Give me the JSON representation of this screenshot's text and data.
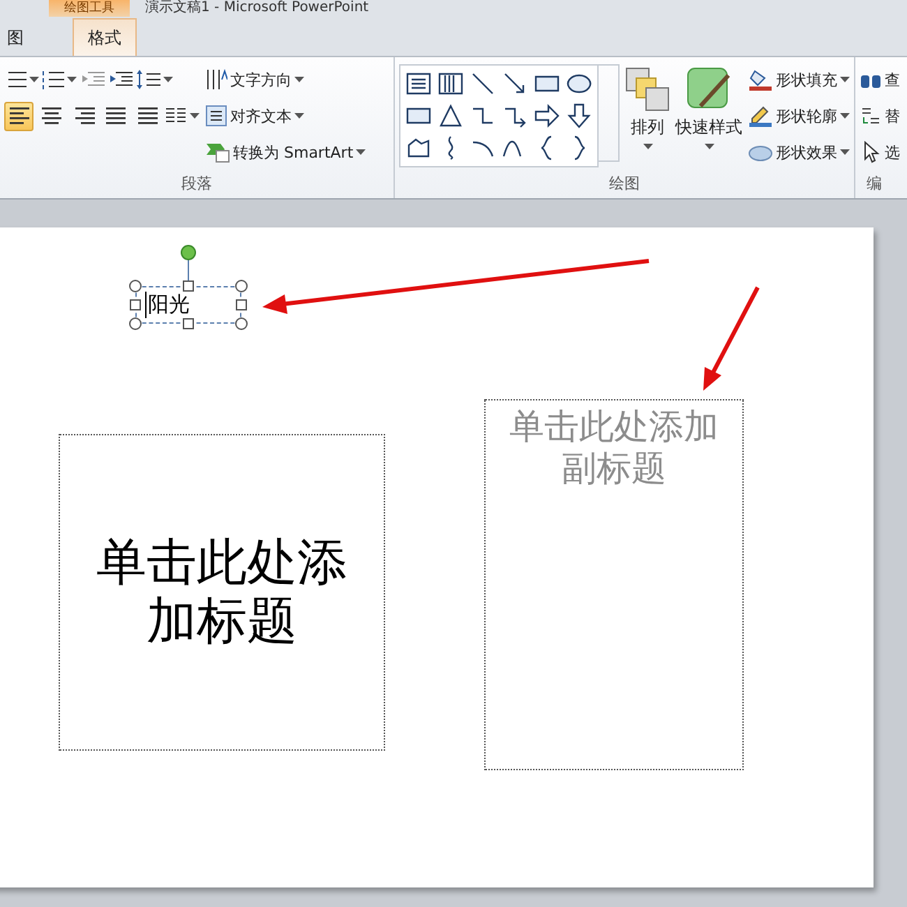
{
  "title_bar": {
    "context_tab": "绘图工具",
    "title": "演示文稿1 - Microsoft PowerPoint"
  },
  "tabs": [
    {
      "label": "图",
      "selected": false
    },
    {
      "label": "格式",
      "selected": true
    }
  ],
  "paragraph_group": {
    "label": "段落",
    "align_buttons": [
      {
        "kind": "left",
        "selected": true
      },
      {
        "kind": "center",
        "selected": false
      },
      {
        "kind": "right",
        "selected": false
      },
      {
        "kind": "justify",
        "selected": false
      },
      {
        "kind": "distributed",
        "selected": false
      }
    ],
    "commands": [
      {
        "kind": "direction",
        "label": "文字方向"
      },
      {
        "kind": "align",
        "label": "对齐文本"
      },
      {
        "kind": "smartart",
        "label": "转换为 SmartArt"
      }
    ]
  },
  "drawing_group": {
    "label": "绘图",
    "arrange": "排列",
    "quick_styles": "快速样式",
    "commands": [
      {
        "kind": "fill",
        "label": "形状填充"
      },
      {
        "kind": "outline",
        "label": "形状轮廓"
      },
      {
        "kind": "effects",
        "label": "形状效果"
      }
    ]
  },
  "editing_group": {
    "label": "编",
    "commands": [
      {
        "kind": "find",
        "label": "查"
      },
      {
        "kind": "replace",
        "label": "替"
      },
      {
        "kind": "select",
        "label": "选"
      }
    ]
  },
  "slide": {
    "text_box": {
      "text": "阳光",
      "selected": true
    },
    "title_placeholder": "单击此处添加标题",
    "subtitle_placeholder": "单击此处添加副标题"
  }
}
